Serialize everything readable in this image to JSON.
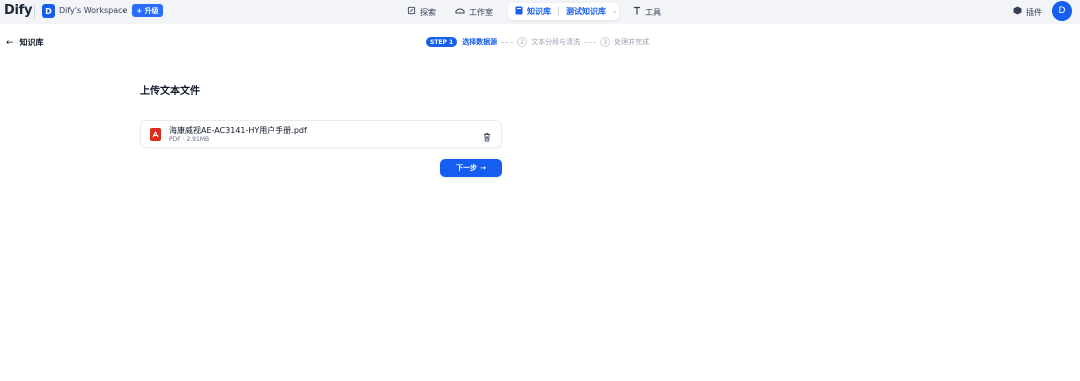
{
  "header": {
    "logo": "Dify",
    "workspace": {
      "avatar": "D",
      "name": "Dify's Workspace",
      "upgrade_label": "升级"
    },
    "nav": {
      "explore": "探索",
      "studio": "工作室",
      "knowledge": "知识库",
      "current_kb": "测试知识库",
      "tools": "工具"
    },
    "plugins": "插件",
    "user_avatar": "D"
  },
  "subheader": {
    "back_label": "知识库",
    "steps": [
      {
        "badge": "STEP 1",
        "label": "选择数据源",
        "active": true
      },
      {
        "number": "2",
        "label": "文本分段与清洗",
        "active": false
      },
      {
        "number": "3",
        "label": "处理并完成",
        "active": false
      }
    ]
  },
  "main": {
    "title": "上传文本文件",
    "file": {
      "name": "海康威视AE-AC3141-HY用户手册.pdf",
      "type": "PDF",
      "size": "2.91MB"
    },
    "next_label": "下一步"
  },
  "colors": {
    "accent": "#155eef",
    "pdf": "#d92d20",
    "topbar_bg": "#f2f4f7"
  }
}
